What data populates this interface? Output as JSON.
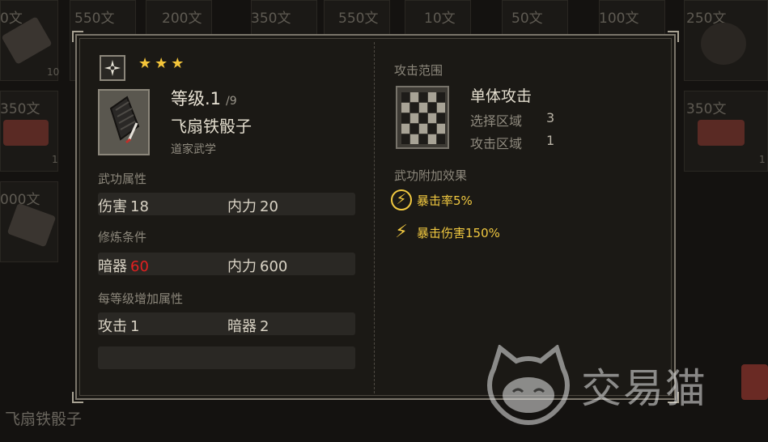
{
  "background": {
    "top_prices": [
      "550文",
      "200文",
      "350文",
      "550文",
      "10文",
      "50文",
      "100文",
      "250文"
    ],
    "partial_prices": [
      "0文",
      "350文",
      "350文",
      "000文"
    ],
    "bottom_item_name": "飞扇铁骰子",
    "badge_numbers": [
      "10",
      "1",
      "1"
    ]
  },
  "panel": {
    "stars": [
      "★",
      "★",
      "★"
    ],
    "level_label": "等级.1",
    "level_max": "/9",
    "item_name": "飞扇铁骰子",
    "item_school": "道家武学",
    "martial_attrs_label": "武功属性",
    "martial_attrs": [
      {
        "name": "伤害",
        "value": "18"
      },
      {
        "name": "内力",
        "value": "20"
      }
    ],
    "requirements_label": "修炼条件",
    "requirements": [
      {
        "name": "暗器",
        "value": "60",
        "highlight": "#e02020"
      },
      {
        "name": "内力",
        "value": "600"
      }
    ],
    "per_level_label": "每等级增加属性",
    "per_level": [
      {
        "name": "攻击",
        "value": "1"
      },
      {
        "name": "暗器",
        "value": "2"
      }
    ],
    "range_label": "攻击范围",
    "range_name": "单体攻击",
    "select_area_label": "选择区域",
    "select_area_value": "3",
    "attack_area_label": "攻击区域",
    "attack_area_value": "1",
    "effects_label": "武功附加效果",
    "effects": [
      {
        "text": "暴击率5%",
        "icon": "lightning-circle-icon"
      },
      {
        "text": "暴击伤害150%",
        "icon": "lightning-icon"
      }
    ]
  },
  "watermark": {
    "text": "交易猫"
  },
  "colors": {
    "accent_gold": "#f0c840",
    "warning_red": "#e02020",
    "panel_bg": "#1b1915"
  }
}
